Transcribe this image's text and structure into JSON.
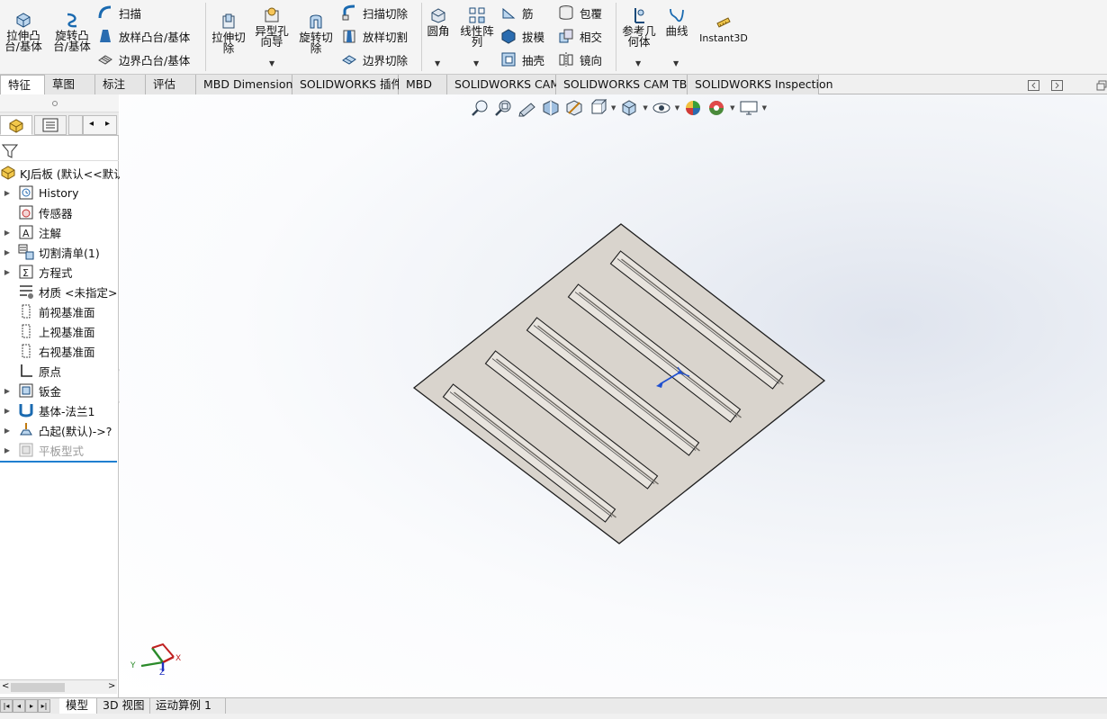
{
  "ribbon": {
    "extrude_boss": "拉伸凸\n台/基体",
    "revolve_boss": "旋转凸\n台/基体",
    "sweep": "扫描",
    "loft_boss": "放样凸台/基体",
    "boundary_boss": "边界凸台/基体",
    "extrude_cut": "拉伸切\n除",
    "hole_wizard": "异型孔\n向导",
    "revolve_cut": "旋转切\n除",
    "swept_cut": "扫描切除",
    "lofted_cut": "放样切割",
    "boundary_cut": "边界切除",
    "fillet": "圆角",
    "linear_pattern": "线性阵\n列",
    "rib": "筋",
    "draft": "拔模",
    "shell": "抽壳",
    "wrap": "包覆",
    "intersect": "相交",
    "mirror": "镜向",
    "ref_geometry": "参考几\n何体",
    "curves": "曲线",
    "instant3d": "Instant3D"
  },
  "tabs": [
    {
      "label": "特征",
      "active": true
    },
    {
      "label": "草图"
    },
    {
      "label": "标注"
    },
    {
      "label": "评估"
    },
    {
      "label": "MBD Dimensions"
    },
    {
      "label": "SOLIDWORKS 插件"
    },
    {
      "label": "MBD"
    },
    {
      "label": "SOLIDWORKS CAM"
    },
    {
      "label": "SOLIDWORKS CAM TBM"
    },
    {
      "label": "SOLIDWORKS Inspection"
    }
  ],
  "tree": {
    "root": "KJ后板 (默认<<默认",
    "items": [
      {
        "label": "History",
        "expand": true
      },
      {
        "label": "传感器",
        "expand": false
      },
      {
        "label": "注解",
        "expand": true
      },
      {
        "label": "切割清单(1)",
        "expand": true
      },
      {
        "label": "方程式",
        "expand": true
      },
      {
        "label": "材质 <未指定>",
        "expand": false
      },
      {
        "label": "前视基准面",
        "expand": false
      },
      {
        "label": "上视基准面",
        "expand": false
      },
      {
        "label": "右视基准面",
        "expand": false
      },
      {
        "label": "原点",
        "expand": false
      },
      {
        "label": "钣金",
        "expand": true
      },
      {
        "label": "基体-法兰1",
        "expand": true
      },
      {
        "label": "凸起(默认)->?",
        "expand": true
      },
      {
        "label": "平板型式",
        "expand": true,
        "dim": true
      }
    ]
  },
  "bottom_tabs": [
    "模型",
    "3D 视图",
    "运动算例 1"
  ],
  "triad": {
    "x": "X",
    "y": "Y",
    "z": "Z"
  },
  "colors": {
    "plate": "#d8d3cc",
    "rib": "#e6e2dc",
    "edge": "#222222",
    "accent": "#1f7fd0"
  }
}
